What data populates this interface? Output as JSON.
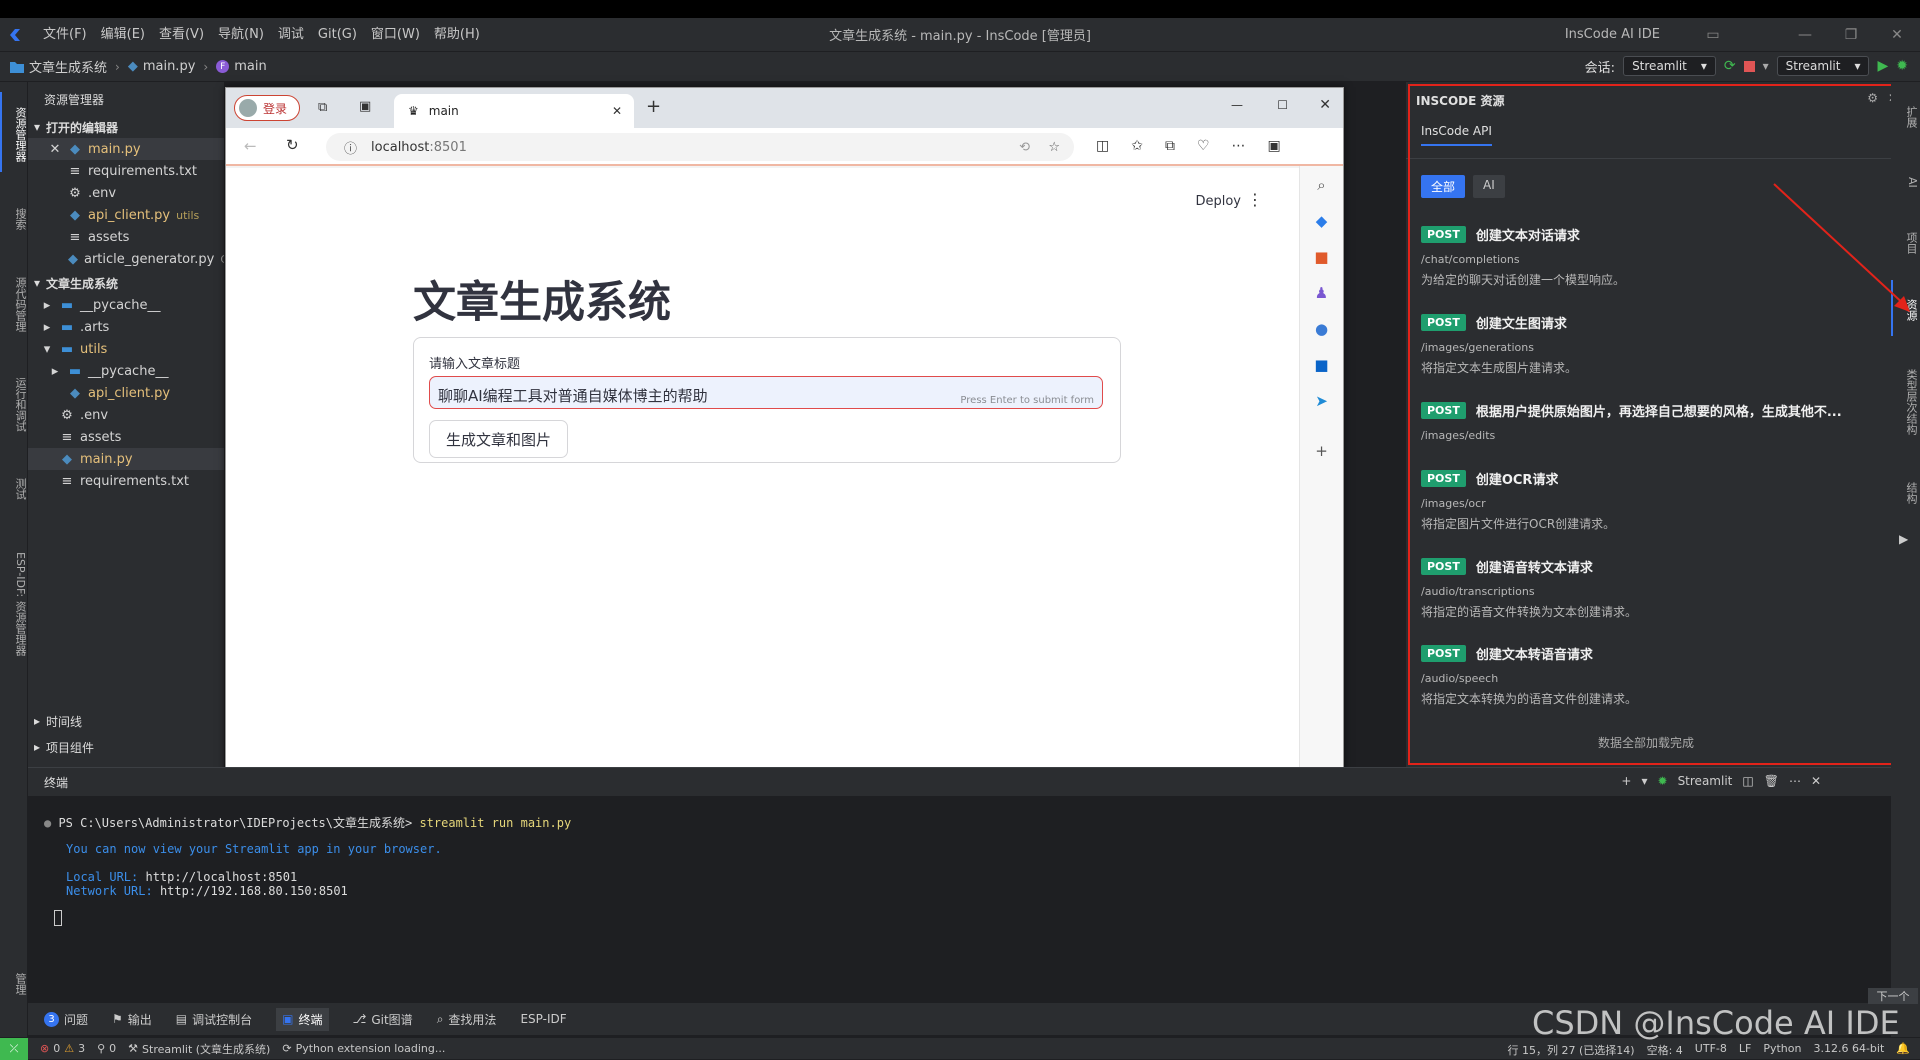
{
  "titlebar": {
    "menus": [
      "文件(F)",
      "编辑(E)",
      "查看(V)",
      "导航(N)",
      "调试",
      "Git(G)",
      "窗口(W)",
      "帮助(H)"
    ],
    "window_title": "文章生成系统 - main.py - InsCode [管理员]",
    "ide_name": "InsCode AI IDE"
  },
  "breadcrumb": {
    "project": "文章生成系统",
    "file": "main.py",
    "symbol": "main",
    "session_label": "会话:",
    "session_value": "Streamlit",
    "run_config": "Streamlit"
  },
  "left_activity": [
    "资源管理器",
    "搜索",
    "源代码管理",
    "运行和调试",
    "测试",
    "ESP-IDF: 资源管理器",
    "管理"
  ],
  "explorer": {
    "title": "资源管理器",
    "open_editors_label": "打开的编辑器",
    "open_editors": [
      {
        "name": "main.py",
        "hint": ""
      },
      {
        "name": "requirements.txt",
        "hint": ""
      },
      {
        "name": ".env",
        "hint": ""
      },
      {
        "name": "api_client.py",
        "hint": "utils"
      },
      {
        "name": "assets",
        "hint": ""
      },
      {
        "name": "article_generator.py",
        "hint": "C"
      }
    ],
    "project_label": "文章生成系统",
    "tree": [
      "__pycache__",
      ".arts",
      "utils",
      "__pycache__",
      "api_client.py",
      ".env",
      "assets",
      "main.py",
      "requirements.txt"
    ],
    "timeline_label": "时间线",
    "components_label": "项目组件"
  },
  "browser": {
    "login": "登录",
    "tab_title": "main",
    "url_host": "localhost",
    "url_port": ":8501",
    "deploy": "Deploy",
    "app_title": "文章生成系统",
    "input_label": "请输入文章标题",
    "input_value": "聊聊AI编程工具对普通自媒体博主的帮助",
    "input_hint": "Press Enter to submit form",
    "button": "生成文章和图片"
  },
  "inscode": {
    "title": "INSCODE 资源",
    "tab": "InsCode API",
    "filters": [
      "全部",
      "AI"
    ],
    "apis": [
      {
        "method": "POST",
        "name": "创建文本对话请求",
        "path": "/chat/completions",
        "desc": "为给定的聊天对话创建一个模型响应。"
      },
      {
        "method": "POST",
        "name": "创建文生图请求",
        "path": "/images/generations",
        "desc": "将指定文本生成图片建请求。"
      },
      {
        "method": "POST",
        "name": "根据用户提供原始图片，再选择自己想要的风格，生成其他不...",
        "path": "/images/edits",
        "desc": ""
      },
      {
        "method": "POST",
        "name": "创建OCR请求",
        "path": "/images/ocr",
        "desc": "将指定图片文件进行OCR创建请求。"
      },
      {
        "method": "POST",
        "name": "创建语音转文本请求",
        "path": "/audio/transcriptions",
        "desc": "将指定的语音文件转换为文本创建请求。"
      },
      {
        "method": "POST",
        "name": "创建文本转语音请求",
        "path": "/audio/speech",
        "desc": "将指定文本转换为的语音文件创建请求。"
      }
    ],
    "loaded": "数据全部加载完成"
  },
  "right_activity": [
    "扩展",
    "AI",
    "项目",
    "资源",
    "类型层次结构",
    "结构"
  ],
  "terminal": {
    "title": "终端",
    "profile": "Streamlit",
    "prompt": "PS C:\\Users\\Administrator\\IDEProjects\\文章生成系统>",
    "command": "streamlit run main.py",
    "line1": "You can now view your Streamlit app in your browser.",
    "local_label": "Local URL:",
    "local_url": "http://localhost:8501",
    "network_label": "Network URL:",
    "network_url": "http://192.168.80.150:8501"
  },
  "tooltabs": {
    "problems_count": "3",
    "items": [
      "问题",
      "输出",
      "调试控制台",
      "终端",
      "Git图谱",
      "查找用法",
      "ESP-IDF"
    ],
    "next": "下一个"
  },
  "status": {
    "errors": "0",
    "warnings": "3",
    "ports": "0",
    "streamlit": "Streamlit (文章生成系统)",
    "python": "Python extension loading...",
    "position": "行 15，列 27 (已选择14)",
    "spaces": "空格: 4",
    "encoding": "UTF-8",
    "eol": "LF",
    "language": "Python",
    "interpreter": "3.12.6 64-bit"
  },
  "watermark": "CSDN @InsCode AI IDE",
  "colors": {
    "accent": "#3574f0",
    "post": "#1f9e6e",
    "highlight": "#e2231a"
  }
}
